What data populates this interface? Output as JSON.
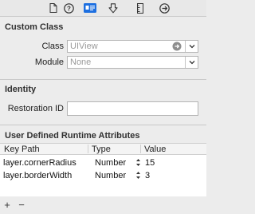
{
  "toolbar": {
    "icons": [
      "file-icon",
      "help-icon",
      "identity-icon",
      "attributes-icon",
      "size-icon",
      "connections-icon"
    ]
  },
  "custom_class": {
    "title": "Custom Class",
    "class_label": "Class",
    "class_value": "UIView",
    "module_label": "Module",
    "module_value": "None"
  },
  "identity": {
    "title": "Identity",
    "restoration_id_label": "Restoration ID",
    "restoration_id_value": ""
  },
  "runtime_attributes": {
    "title": "User Defined Runtime Attributes",
    "columns": [
      "Key Path",
      "Type",
      "Value"
    ],
    "rows": [
      {
        "key_path": "layer.cornerRadius",
        "type": "Number",
        "value": "15"
      },
      {
        "key_path": "layer.borderWidth",
        "type": "Number",
        "value": "3"
      }
    ],
    "add_label": "+",
    "remove_label": "−"
  },
  "colors": {
    "background": "#ececec",
    "selected_tab": "#1d6fe0"
  }
}
